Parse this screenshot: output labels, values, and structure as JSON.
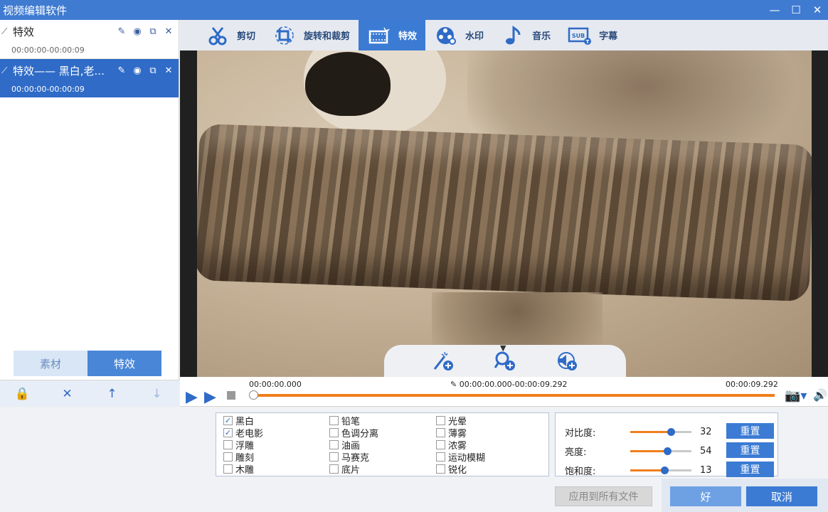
{
  "window": {
    "title": "视频编辑软件",
    "min": "—",
    "max": "☐",
    "close": "✕"
  },
  "effect_list": [
    {
      "name": "特效",
      "time": "00:00:00-00:00:09",
      "selected": false
    },
    {
      "name": "特效—— 黑白,老...",
      "time": "00:00:00-00:00:09",
      "selected": true
    }
  ],
  "item_actions": {
    "edit": "✎",
    "view": "◉",
    "copy": "⧉",
    "delete": "✕"
  },
  "left_tabs": {
    "material": "素材",
    "effects": "特效"
  },
  "left_bottom": {
    "lock": "🔒",
    "delete": "✕",
    "up": "↑",
    "down": "↓"
  },
  "toolbar": {
    "cut": "剪切",
    "rotate_crop": "旋转和裁剪",
    "effects": "特效",
    "watermark": "水印",
    "music": "音乐",
    "subtitle": "字幕"
  },
  "timeline": {
    "start": "00:00:00.000",
    "range": "00:00:00.000-00:00:09.292",
    "end": "00:00:09.292",
    "position": 0
  },
  "effects": {
    "col1": [
      {
        "label": "黑白",
        "checked": true
      },
      {
        "label": "老电影",
        "checked": true
      },
      {
        "label": "浮雕",
        "checked": false
      },
      {
        "label": "雕刻",
        "checked": false
      },
      {
        "label": "木雕",
        "checked": false
      }
    ],
    "col2": [
      {
        "label": "铅笔",
        "checked": false
      },
      {
        "label": "色调分离",
        "checked": false
      },
      {
        "label": "油画",
        "checked": false
      },
      {
        "label": "马赛克",
        "checked": false
      },
      {
        "label": "底片",
        "checked": false
      }
    ],
    "col3": [
      {
        "label": "光晕",
        "checked": false
      },
      {
        "label": "薄雾",
        "checked": false
      },
      {
        "label": "浓雾",
        "checked": false
      },
      {
        "label": "运动模糊",
        "checked": false
      },
      {
        "label": "锐化",
        "checked": false
      }
    ]
  },
  "adjust": {
    "contrast": {
      "label": "对比度:",
      "value": "32",
      "level": 0.66
    },
    "brightness": {
      "label": "亮度:",
      "value": "54",
      "level": 0.6
    },
    "saturation": {
      "label": "饱和度:",
      "value": "13",
      "level": 0.56
    },
    "reset_label": "重置"
  },
  "buttons": {
    "apply_all": "应用到所有文件",
    "ok": "好",
    "cancel": "取消"
  },
  "colors": {
    "accent": "#3b7bd4",
    "title_bar": "#3f7bd1",
    "timeline": "#f07f1c"
  }
}
